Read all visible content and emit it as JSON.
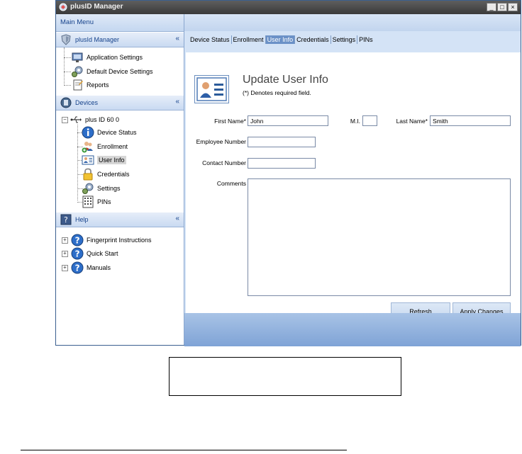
{
  "window": {
    "title": "plusID Manager",
    "controls": [
      "_",
      "□",
      "×"
    ]
  },
  "nav": {
    "header": "Main Menu",
    "sections": [
      {
        "label": "plusId Manager",
        "icon": "shield-icon",
        "items": [
          {
            "label": "Application Settings",
            "icon": "monitor-icon"
          },
          {
            "label": "Default Device Settings",
            "icon": "gears-icon"
          },
          {
            "label": "Reports",
            "icon": "report-icon"
          }
        ]
      },
      {
        "label": "Devices",
        "icon": "devices-icon",
        "device": {
          "label": "plus ID 60 0",
          "icon": "usb-icon",
          "expander": "−"
        },
        "items": [
          {
            "label": "Device Status",
            "icon": "info-icon"
          },
          {
            "label": "Enrollment",
            "icon": "enroll-users-icon"
          },
          {
            "label": "User Info",
            "icon": "user-card-icon",
            "selected": true
          },
          {
            "label": "Credentials",
            "icon": "lock-icon"
          },
          {
            "label": "Settings",
            "icon": "gears-icon"
          },
          {
            "label": "PINs",
            "icon": "keypad-icon"
          }
        ]
      },
      {
        "label": "Help",
        "icon": "help-book-icon",
        "items": [
          {
            "label": "Fingerprint Instructions",
            "icon": "help-icon",
            "expander": "+"
          },
          {
            "label": "Quick Start",
            "icon": "help-icon",
            "expander": "+"
          },
          {
            "label": "Manuals",
            "icon": "help-icon",
            "expander": "+"
          }
        ]
      }
    ],
    "collapse_glyph": "«"
  },
  "tabs": [
    "Device Status",
    "Enrollment",
    "User Info",
    "Credentials",
    "Settings",
    "PINs"
  ],
  "active_tab": "User Info",
  "form": {
    "title": "Update User Info",
    "required_note": "(*) Denotes required field.",
    "first_name_label": "First Name*",
    "first_name_value": "John",
    "mi_label": "M.I.",
    "mi_value": "",
    "last_name_label": "Last Name*",
    "last_name_value": "Smith",
    "employee_number_label": "Employee Number",
    "employee_number_value": "",
    "contact_number_label": "Contact Number",
    "contact_number_value": "",
    "comments_label": "Comments",
    "comments_value": "",
    "refresh_label": "Refresh",
    "apply_label": "Apply Changes"
  },
  "colors": {
    "accent": "#6b91c7",
    "nav_text": "#15428b",
    "panel_bg": "#d4e3f6"
  }
}
